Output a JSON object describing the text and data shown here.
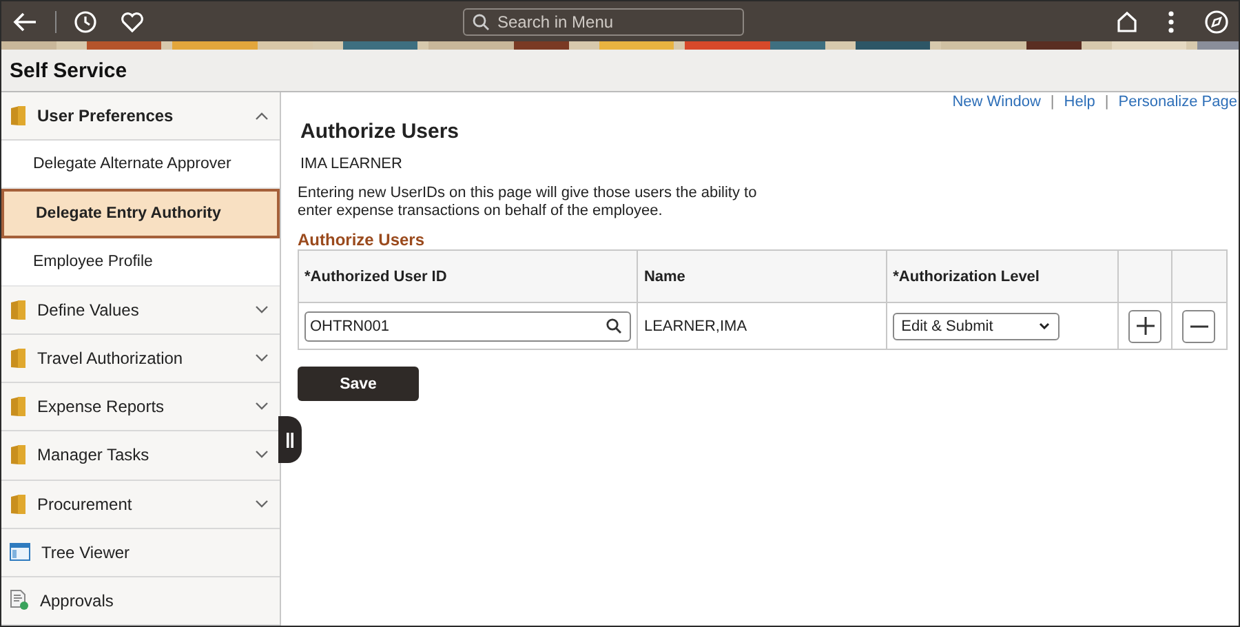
{
  "top_bar": {
    "search": {
      "placeholder": "Search in Menu"
    }
  },
  "header": {
    "title": "Self Service"
  },
  "sidebar": {
    "items": [
      {
        "kind": "folder",
        "label": "User Preferences",
        "expanded": true,
        "children": [
          {
            "label": "Delegate Alternate Approver",
            "selected": false
          },
          {
            "label": "Delegate Entry Authority",
            "selected": true
          },
          {
            "label": "Employee Profile",
            "selected": false
          }
        ]
      },
      {
        "kind": "folder",
        "label": "Define Values",
        "expanded": false
      },
      {
        "kind": "folder",
        "label": "Travel Authorization",
        "expanded": false
      },
      {
        "kind": "folder",
        "label": "Expense Reports",
        "expanded": false
      },
      {
        "kind": "folder",
        "label": "Manager Tasks",
        "expanded": false
      },
      {
        "kind": "folder",
        "label": "Procurement",
        "expanded": false
      },
      {
        "kind": "tree",
        "label": "Tree Viewer"
      },
      {
        "kind": "approvals",
        "label": "Approvals"
      }
    ]
  },
  "links": [
    {
      "label": "New Window",
      "separator": "|"
    },
    {
      "label": "Help",
      "separator": "|"
    },
    {
      "label": "Personalize Page"
    }
  ],
  "page": {
    "title": "Authorize Users",
    "employee": "IMA LEARNER",
    "description": "Entering new UserIDs on this page will give those users the ability to enter expense transactions on behalf of the employee.",
    "section_title": "Authorize Users",
    "table": {
      "columns": [
        "*Authorized User ID",
        "Name",
        "*Authorization Level"
      ],
      "rows": [
        {
          "user_id": "OHTRN001",
          "name": "LEARNER,IMA",
          "level": "Edit & Submit"
        }
      ]
    },
    "save_button": "Save"
  }
}
